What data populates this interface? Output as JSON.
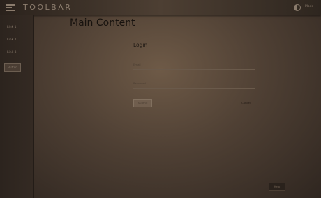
{
  "toolbar": {
    "title": "TOOLBAR",
    "menu_icon": "menu-icon",
    "theme_icon": "contrast-icon",
    "theme_label": "Mode"
  },
  "sidebar": {
    "items": [
      {
        "label": "Link 1"
      },
      {
        "label": "Link 2"
      },
      {
        "label": "Link 3"
      }
    ],
    "button_label": "Button"
  },
  "main": {
    "title": "Main Content",
    "login": {
      "title": "Login",
      "email_label": "Email",
      "password_label": "Password",
      "submit_label": "Submit",
      "cancel_label": "Cancel"
    },
    "fab_label": "Help"
  },
  "colors": {
    "background": "#4f4034",
    "toolbar": "#2a221c",
    "sidebar": "#2c241e"
  }
}
